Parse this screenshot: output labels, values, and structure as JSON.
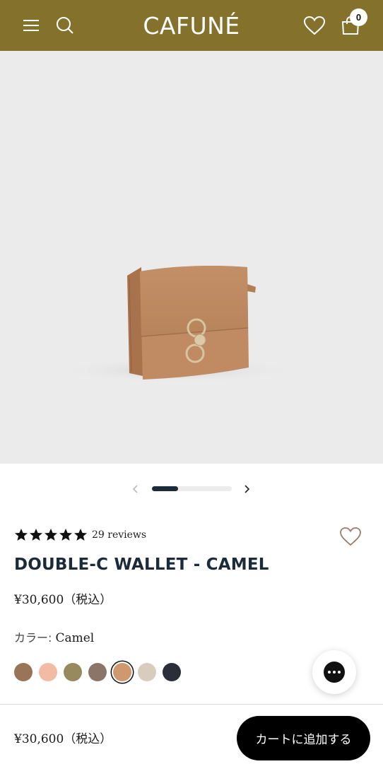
{
  "header": {
    "logo": "CAFUNÉ",
    "cart_count": "0",
    "background": "#84712c",
    "icons": [
      "menu-icon",
      "search-icon",
      "heart-icon",
      "shopping-bag-icon"
    ]
  },
  "gallery": {
    "progress_fraction": 0.33,
    "icons": [
      "chevron-left-icon",
      "chevron-right-icon"
    ]
  },
  "product": {
    "rating": 5,
    "reviews": "29 reviews",
    "title": "DOUBLE-C WALLET - CAMEL",
    "price": "¥30,600（税込）",
    "color_label": "カラー: ",
    "color_value": "Camel",
    "swatches": [
      {
        "name": "brown",
        "color": "#9a7456"
      },
      {
        "name": "peach",
        "color": "#f1bca3"
      },
      {
        "name": "olive",
        "color": "#968a5e"
      },
      {
        "name": "taupe",
        "color": "#8b7569"
      },
      {
        "name": "camel",
        "color": "#cf986e",
        "selected": true
      },
      {
        "name": "beige",
        "color": "#d8cdbd"
      },
      {
        "name": "navy",
        "color": "#2a2e38"
      }
    ]
  },
  "bottom_bar": {
    "price": "¥30,600（税込）",
    "cta": "カートに追加する"
  }
}
